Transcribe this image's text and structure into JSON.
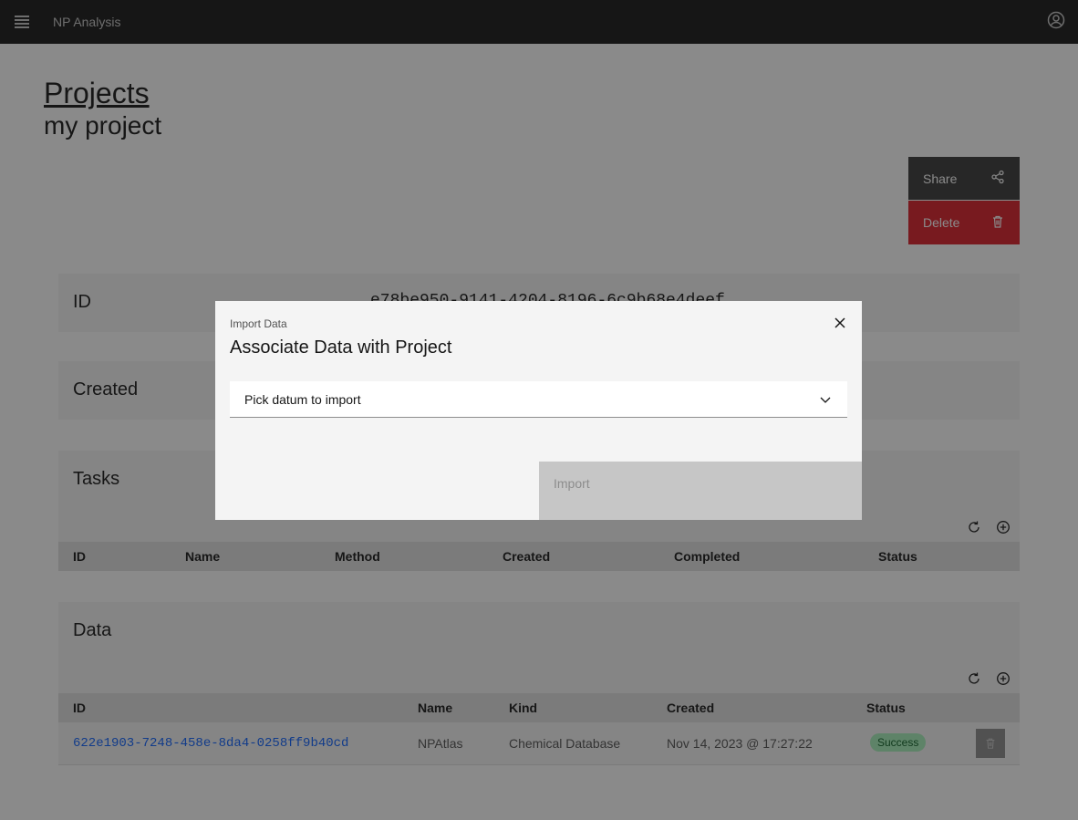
{
  "header": {
    "app_name": "NP Analysis"
  },
  "breadcrumb": {
    "link": "Projects"
  },
  "project": {
    "name": "my project"
  },
  "actions": {
    "share": "Share",
    "delete": "Delete"
  },
  "id_tile": {
    "label": "ID",
    "value": "e78be950-9141-4204-8196-6c9b68e4deef"
  },
  "created_tile": {
    "label": "Created"
  },
  "tasks": {
    "title": "Tasks",
    "columns": [
      "ID",
      "Name",
      "Method",
      "Created",
      "Completed",
      "Status"
    ]
  },
  "data_section": {
    "title": "Data",
    "columns": [
      "ID",
      "Name",
      "Kind",
      "Created",
      "Status"
    ],
    "rows": [
      {
        "id": "622e1903-7248-458e-8da4-0258ff9b40cd",
        "name": "NPAtlas",
        "kind": "Chemical Database",
        "created": "Nov 14, 2023 @ 17:27:22",
        "status": "Success"
      }
    ]
  },
  "modal": {
    "label": "Import Data",
    "heading": "Associate Data with Project",
    "select_placeholder": "Pick datum to import",
    "import_button": "Import"
  },
  "colors": {
    "header_bg": "#161616",
    "danger": "#da1e28",
    "link": "#0f62fe",
    "success_bg": "#a7f0ba"
  }
}
